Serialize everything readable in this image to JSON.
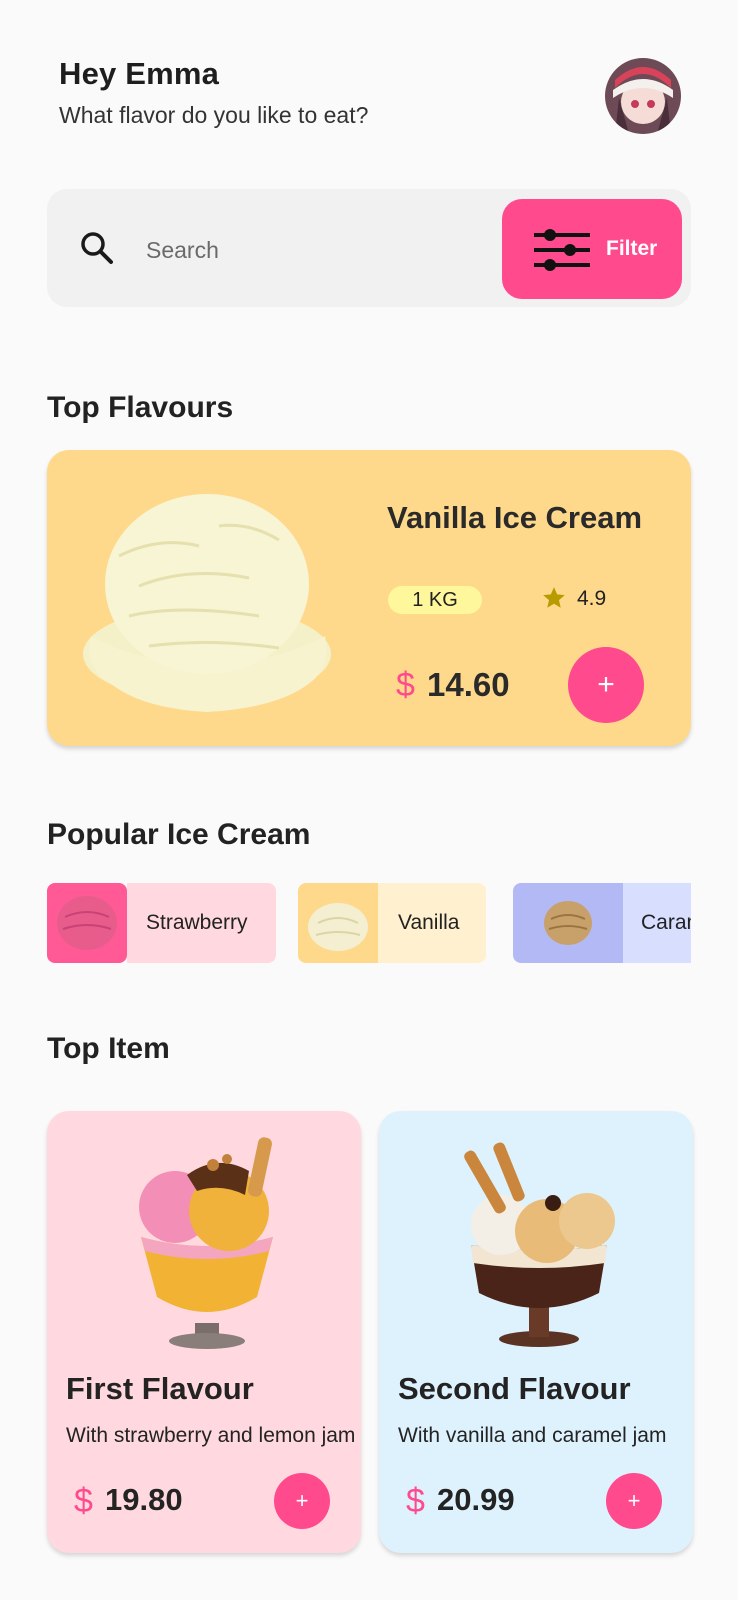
{
  "header": {
    "greeting": "Hey Emma",
    "subtitle": "What flavor do you like to eat?"
  },
  "search": {
    "placeholder": "Search",
    "filter_label": "Filter"
  },
  "sections": {
    "top_flavours": "Top Flavours",
    "popular": "Popular Ice Cream",
    "top_item": "Top Item"
  },
  "top_flavour": {
    "name": "Vanilla Ice Cream",
    "weight": "1 KG",
    "rating": "4.9",
    "currency": "$",
    "price": "14.60",
    "add_label": "+"
  },
  "popular": [
    {
      "label": "Strawberry",
      "thumb_color": "#ff5a95",
      "label_bg": "#ffd9df"
    },
    {
      "label": "Vanilla",
      "thumb_color": "#ffd98b",
      "label_bg": "#fff0cf"
    },
    {
      "label": "Caramel",
      "thumb_color": "#b2b9f5",
      "label_bg": "#d8defd"
    }
  ],
  "top_items": [
    {
      "name": "First Flavour",
      "desc": "With strawberry and lemon jam",
      "currency": "$",
      "price": "19.80",
      "add_label": "+",
      "bg": "#ffd9df"
    },
    {
      "name": "Second Flavour",
      "desc": "With vanilla and caramel jam",
      "currency": "$",
      "price": "20.99",
      "add_label": "+",
      "bg": "#def2fd"
    }
  ],
  "colors": {
    "accent": "#ff4a8d",
    "background": "#fafafa"
  }
}
